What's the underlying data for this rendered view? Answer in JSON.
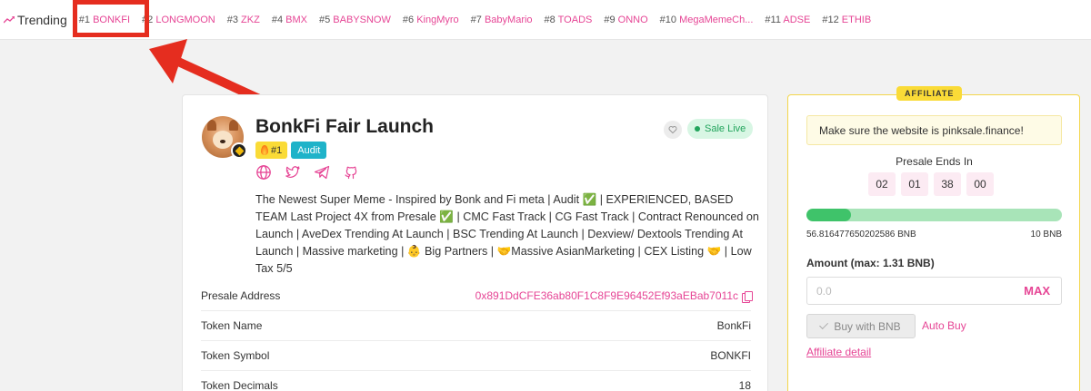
{
  "trending": {
    "label": "Trending",
    "items": [
      {
        "rank": "#1",
        "name": "BONKFI"
      },
      {
        "rank": "#2",
        "name": "LONGMOON"
      },
      {
        "rank": "#3",
        "name": "ZKZ"
      },
      {
        "rank": "#4",
        "name": "BMX"
      },
      {
        "rank": "#5",
        "name": "BABYSNOW"
      },
      {
        "rank": "#6",
        "name": "KingMyro"
      },
      {
        "rank": "#7",
        "name": "BabyMario"
      },
      {
        "rank": "#8",
        "name": "TOADS"
      },
      {
        "rank": "#9",
        "name": "ONNO"
      },
      {
        "rank": "#10",
        "name": "MegaMemeCh..."
      },
      {
        "rank": "#11",
        "name": "ADSE"
      },
      {
        "rank": "#12",
        "name": "ETHIB"
      }
    ]
  },
  "colors": {
    "accent": "#e64595",
    "highlight_box": "#e52d1f",
    "arrow": "#e52d1f",
    "affiliate_yellow": "#fadb37",
    "status_green": "#22a45c",
    "audit_blue": "#1fb3c9"
  },
  "project": {
    "title": "BonkFi Fair Launch",
    "rank_badge": "#1",
    "audit_badge": "Audit",
    "status": "Sale Live",
    "socials": [
      "globe-icon",
      "twitter-icon",
      "telegram-icon",
      "github-icon"
    ],
    "description": "The Newest Super Meme - Inspired by Bonk and Fi meta | Audit ✅ | EXPERIENCED, BASED TEAM Last Project 4X from Presale ✅ | CMC Fast Track | CG Fast Track | Contract Renounced on Launch | AveDex Trending At Launch | BSC Trending At Launch | Dexview/ Dextools Trending At Launch | Massive marketing | 👶 Big Partners | 🤝Massive AsianMarketing | CEX Listing 🤝 | Low Tax 5/5"
  },
  "info": [
    {
      "label": "Presale Address",
      "value": "0x891DdCFE36ab80F1C8F9E96452Ef93aEBab7011c"
    },
    {
      "label": "Token Name",
      "value": "BonkFi"
    },
    {
      "label": "Token Symbol",
      "value": "BONKFI"
    },
    {
      "label": "Token Decimals",
      "value": "18"
    }
  ],
  "sidebar": {
    "affiliate_tag": "AFFILIATE",
    "warning": "Make sure the website is pinksale.finance!",
    "ends_label": "Presale Ends In",
    "countdown": [
      "02",
      "01",
      "38",
      "00"
    ],
    "progress_fraction": 0.176,
    "raised": "56.816477650202586 BNB",
    "hardcap": "10 BNB",
    "amount_label": "Amount (max: 1.31 BNB)",
    "amount_placeholder": "0.0",
    "max_label": "MAX",
    "buy_label": "Buy with BNB",
    "auto_buy": "Auto Buy",
    "affiliate_detail": "Affiliate detail"
  }
}
